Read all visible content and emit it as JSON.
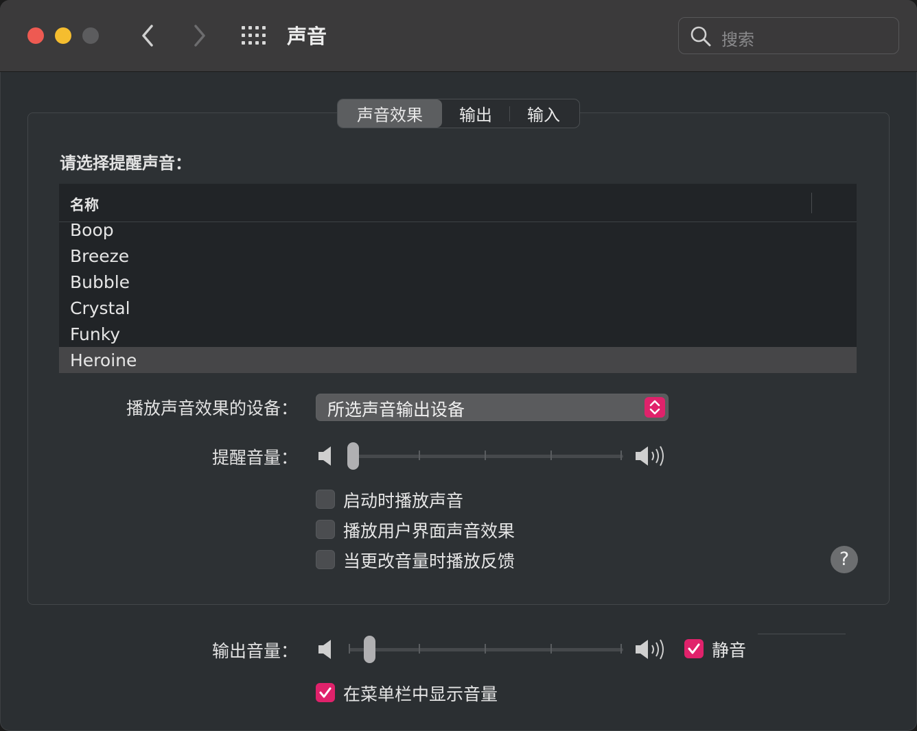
{
  "window": {
    "title": "声音",
    "search": {
      "placeholder": "搜索"
    }
  },
  "tabs": [
    {
      "label": "声音效果",
      "selected": true
    },
    {
      "label": "输出",
      "selected": false
    },
    {
      "label": "输入",
      "selected": false
    }
  ],
  "sound_effects": {
    "prompt": "请选择提醒声音：",
    "list": {
      "column_header": "名称",
      "items": [
        "Boop",
        "Breeze",
        "Bubble",
        "Crystal",
        "Funky",
        "Heroine"
      ],
      "selected": "Heroine"
    },
    "device": {
      "label": "播放声音效果的设备：",
      "value": "所选声音输出设备"
    },
    "alert_volume": {
      "label": "提醒音量：",
      "level": 0.02
    },
    "checkboxes": [
      {
        "label": "启动时播放声音",
        "checked": false
      },
      {
        "label": "播放用户界面声音效果",
        "checked": false
      },
      {
        "label": "当更改音量时播放反馈",
        "checked": false
      }
    ],
    "help_label": "?"
  },
  "output_volume": {
    "label": "输出音量：",
    "level": 0.08,
    "mute": {
      "label": "静音",
      "checked": true
    }
  },
  "menubar_volume": {
    "label": "在菜单栏中显示音量",
    "checked": true
  },
  "colors": {
    "accent": "#e0226b",
    "window_bg": "#2b2f32",
    "titlebar_bg": "#3b3a3b",
    "list_bg": "#212427",
    "selection": "#464648"
  }
}
